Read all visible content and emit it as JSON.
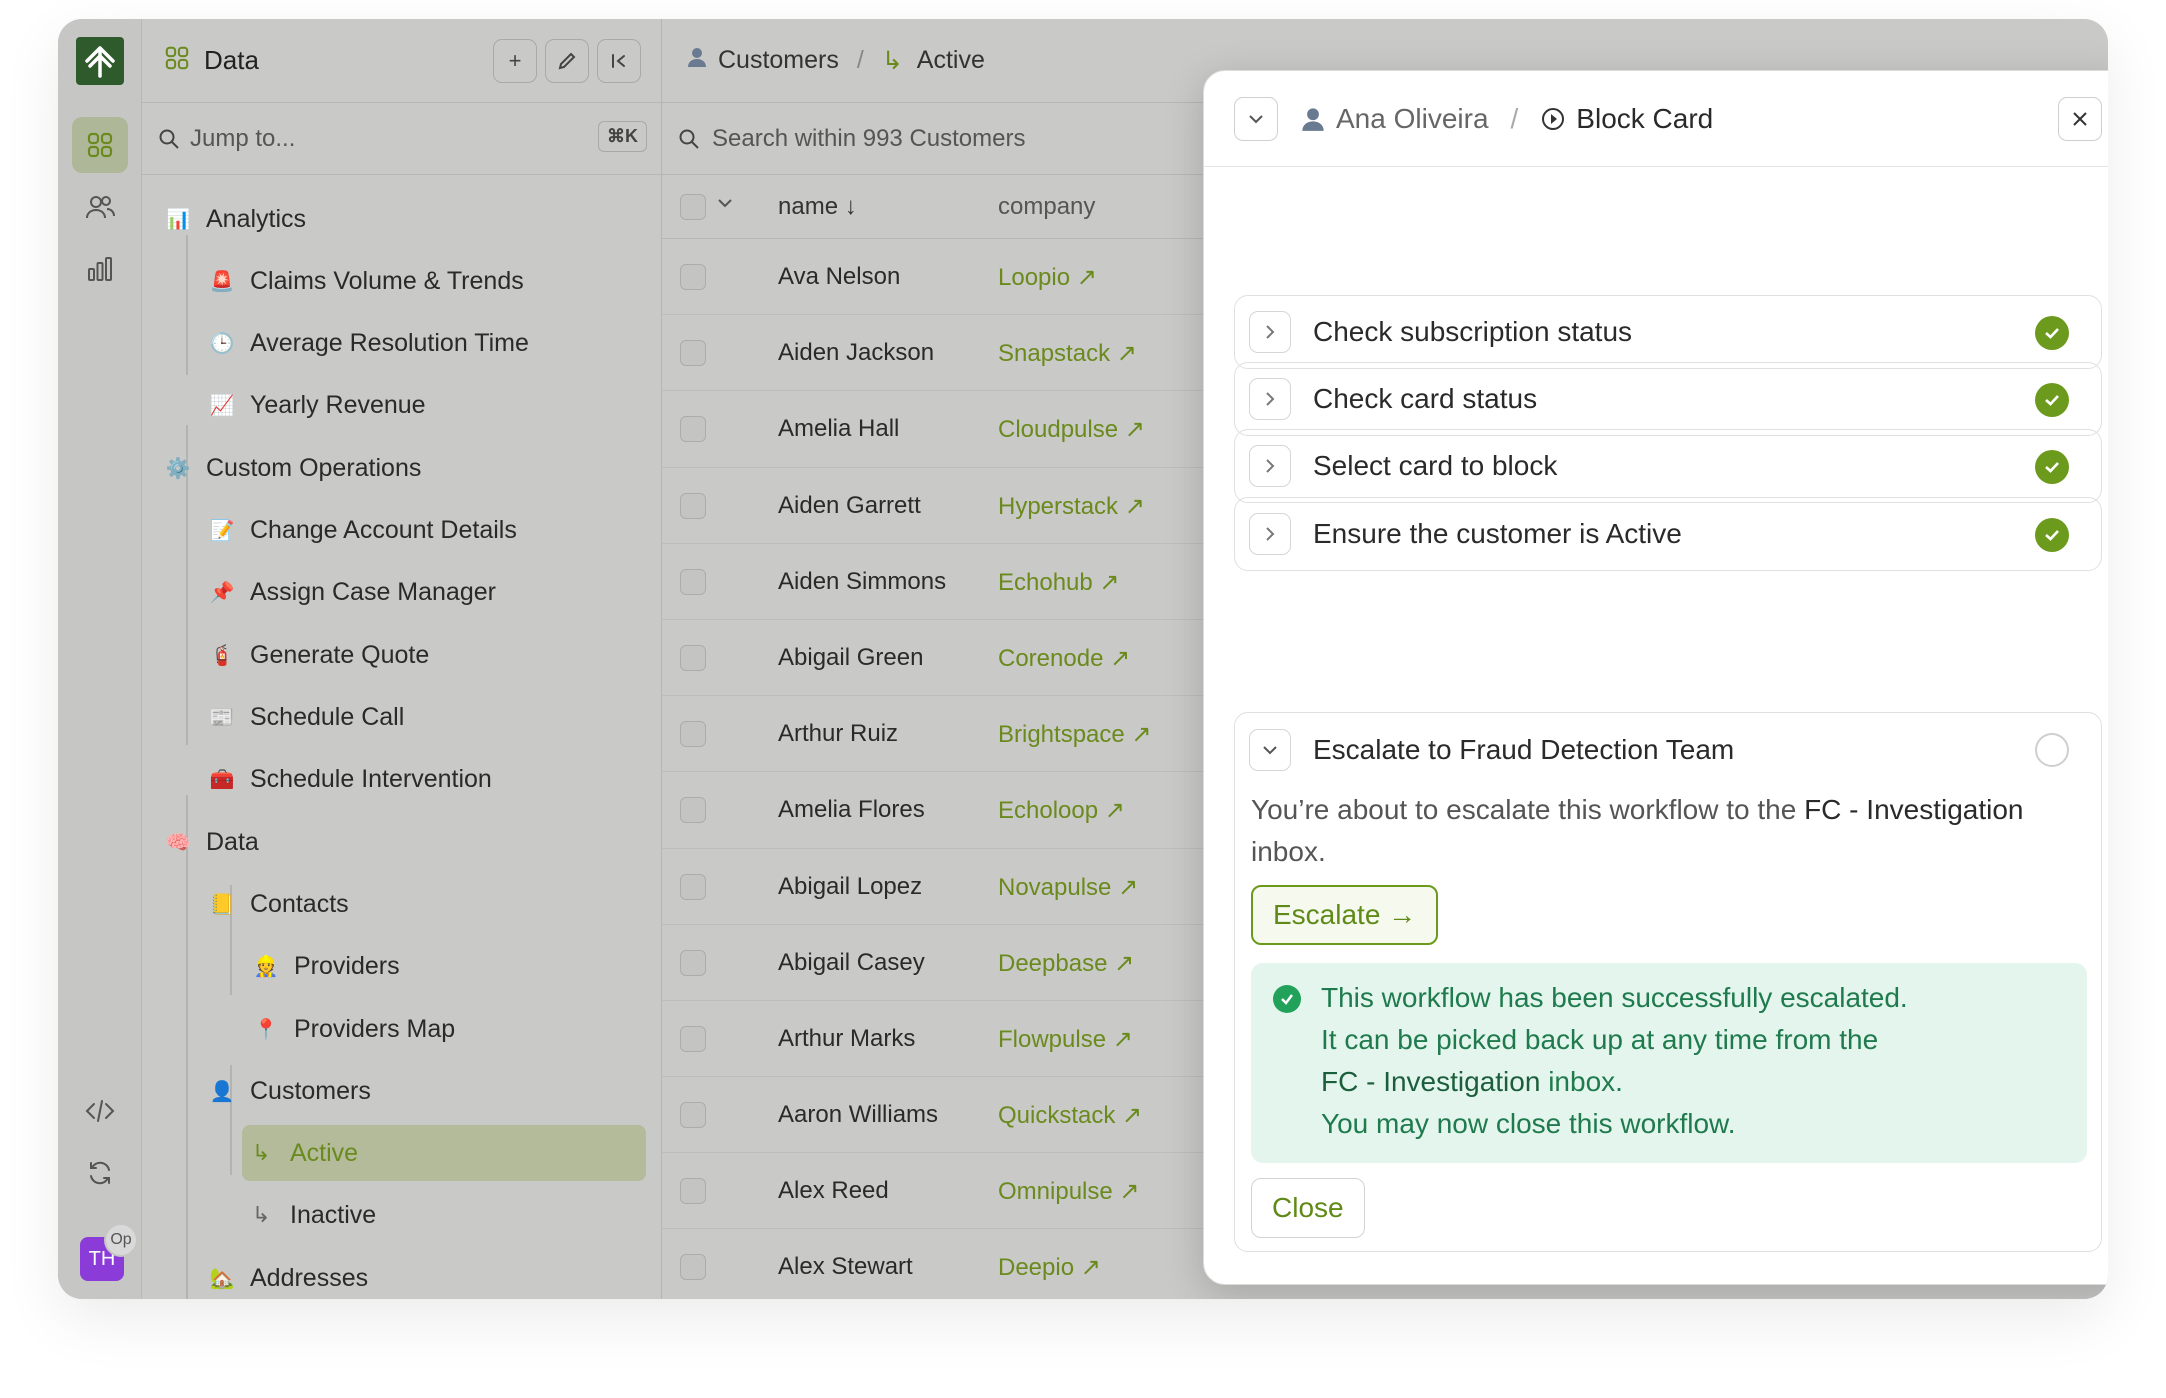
{
  "colors": {
    "accent": "#6b8a1d",
    "success": "#22a15a",
    "avatar": "#8b3bd8"
  },
  "rail": {
    "icons": [
      "logo-icon",
      "grid-icon",
      "users-icon",
      "chart-icon",
      "code-icon",
      "refresh-icon"
    ],
    "avatar_initials": "TH",
    "avatar_badge": "Op"
  },
  "sidebar": {
    "title": "Data",
    "jump_placeholder": "Jump to...",
    "jump_shortcut": "⌘K",
    "items": [
      {
        "label": "Analytics",
        "emoji": "📊"
      },
      {
        "label": "Claims Volume & Trends",
        "emoji": "🚨"
      },
      {
        "label": "Average Resolution Time",
        "emoji": "🕒"
      },
      {
        "label": "Yearly Revenue",
        "emoji": "📈"
      },
      {
        "label": "Custom Operations",
        "emoji": "⚙️"
      },
      {
        "label": "Change Account Details",
        "emoji": "📝"
      },
      {
        "label": "Assign Case Manager",
        "emoji": "📌"
      },
      {
        "label": "Generate Quote",
        "emoji": "🧯"
      },
      {
        "label": "Schedule Call",
        "emoji": "📰"
      },
      {
        "label": "Schedule Intervention",
        "emoji": "🧰"
      },
      {
        "label": "Data",
        "emoji": "🧠"
      },
      {
        "label": "Contacts",
        "emoji": "📒"
      },
      {
        "label": "Providers",
        "emoji": "👷"
      },
      {
        "label": "Providers Map",
        "emoji": "📍"
      },
      {
        "label": "Customers",
        "emoji": "👤"
      },
      {
        "label": "Active",
        "emoji": "↳"
      },
      {
        "label": "Inactive",
        "emoji": "↳"
      },
      {
        "label": "Addresses",
        "emoji": "🏡"
      }
    ]
  },
  "table": {
    "breadcrumb": [
      "Customers",
      "Active"
    ],
    "search_placeholder": "Search within 993 Customers",
    "columns": [
      "name",
      "company"
    ],
    "rows": [
      {
        "name": "Ava Nelson",
        "company": "Loopio ↗"
      },
      {
        "name": "Aiden Jackson",
        "company": "Snapstack ↗"
      },
      {
        "name": "Amelia Hall",
        "company": "Cloudpulse ↗"
      },
      {
        "name": "Aiden Garrett",
        "company": "Hyperstack ↗"
      },
      {
        "name": "Aiden Simmons",
        "company": "Echohub ↗"
      },
      {
        "name": "Abigail Green",
        "company": "Corenode ↗"
      },
      {
        "name": "Arthur Ruiz",
        "company": "Brightspace ↗"
      },
      {
        "name": "Amelia Flores",
        "company": "Echoloop ↗"
      },
      {
        "name": "Abigail Lopez",
        "company": "Novapulse ↗"
      },
      {
        "name": "Abigail Casey",
        "company": "Deepbase ↗"
      },
      {
        "name": "Arthur Marks",
        "company": "Flowpulse ↗"
      },
      {
        "name": "Aaron Williams",
        "company": "Quickstack ↗"
      },
      {
        "name": "Alex Reed",
        "company": "Omnipulse ↗"
      },
      {
        "name": "Alex Stewart",
        "company": "Deepio ↗"
      }
    ]
  },
  "modal": {
    "customer": "Ana Oliveira",
    "workflow": "Block Card",
    "steps": [
      {
        "label": "Check subscription status",
        "done": true
      },
      {
        "label": "Check card status",
        "done": true
      },
      {
        "label": "Select card to block",
        "done": true
      },
      {
        "label": "Ensure the customer is Active",
        "done": true
      }
    ],
    "open_step": {
      "label": "Escalate to Fraud Detection Team",
      "desc_pre": "You’re about to escalate this workflow to the ",
      "desc_inbox": "FC - Investigation",
      "desc_post": " inbox.",
      "escalate_label": "Escalate →",
      "success_line1": "This workflow has been successfully escalated.",
      "success_line2": "It can be picked back up at any time from the",
      "success_inbox": "FC - Investigation",
      "success_line3_post": " inbox.",
      "success_line4": "You may now close this workflow.",
      "close_label": "Close"
    }
  }
}
